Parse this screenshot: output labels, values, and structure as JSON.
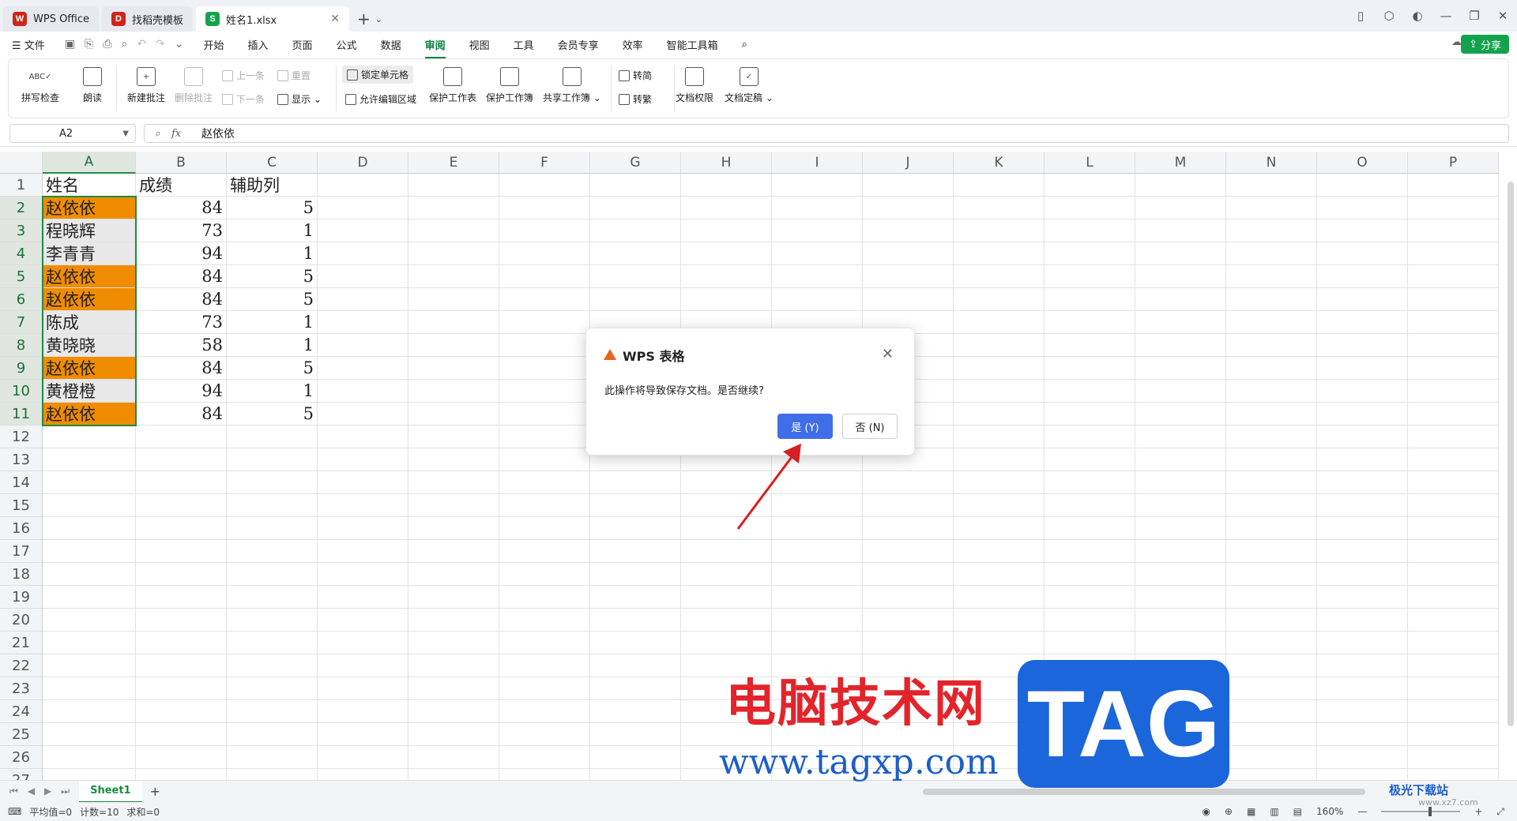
{
  "tabs": [
    {
      "label": "WPS Office",
      "logo": "W",
      "color": "#d0241b",
      "active": false
    },
    {
      "label": "找稻壳模板",
      "logo": "D",
      "color": "#d0241b",
      "active": false
    },
    {
      "label": "姓名1.xlsx",
      "logo": "S",
      "color": "#14a34d",
      "active": true
    }
  ],
  "menu": {
    "file": "文件",
    "items": [
      "开始",
      "插入",
      "页面",
      "公式",
      "数据",
      "审阅",
      "视图",
      "工具",
      "会员专享",
      "效率",
      "智能工具箱"
    ],
    "active": "审阅",
    "share": "分享"
  },
  "ribbon": {
    "spellcheck": "拼写检查",
    "read": "朗读",
    "new_comment": "新建批注",
    "delete_comment": "删除批注",
    "prev": "上一条",
    "next": "下一条",
    "reset": "重置",
    "show": "显示",
    "lock_cell": "锁定单元格",
    "allow_edit": "允许编辑区域",
    "protect_sheet": "保护工作表",
    "protect_book": "保护工作簿",
    "share_book": "共享工作簿",
    "to_simplified": "转简",
    "to_traditional": "转繁",
    "doc_permission": "文档权限",
    "doc_finalize": "文档定稿"
  },
  "formula_bar": {
    "name_box": "A2",
    "value": "赵依依"
  },
  "columns": [
    "A",
    "B",
    "C",
    "D",
    "E",
    "F",
    "G",
    "H",
    "I",
    "J",
    "K",
    "L",
    "M",
    "N",
    "O",
    "P"
  ],
  "rows": [
    "1",
    "2",
    "3",
    "4",
    "5",
    "6",
    "7",
    "8",
    "9",
    "10",
    "11",
    "12",
    "13",
    "14",
    "15",
    "16",
    "17",
    "18",
    "19",
    "20",
    "21",
    "22",
    "23",
    "24",
    "25",
    "26",
    "27"
  ],
  "table": {
    "headers": [
      "姓名",
      "成绩",
      "辅助列"
    ],
    "data": [
      {
        "name": "赵依依",
        "score": "84",
        "aux": "5"
      },
      {
        "name": "程晓辉",
        "score": "73",
        "aux": "1"
      },
      {
        "name": "李青青",
        "score": "94",
        "aux": "1"
      },
      {
        "name": "赵依依",
        "score": "84",
        "aux": "5"
      },
      {
        "name": "赵依依",
        "score": "84",
        "aux": "5"
      },
      {
        "name": "陈成",
        "score": "73",
        "aux": "1"
      },
      {
        "name": "黄晓晓",
        "score": "58",
        "aux": "1"
      },
      {
        "name": "赵依依",
        "score": "84",
        "aux": "5"
      },
      {
        "name": "黄橙橙",
        "score": "94",
        "aux": "1"
      },
      {
        "name": "赵依依",
        "score": "84",
        "aux": "5"
      }
    ],
    "highlight_color": "#f08c00",
    "plain_color": "#e8e8e8"
  },
  "dialog": {
    "title": "WPS 表格",
    "message": "此操作将导致保存文档。是否继续?",
    "yes": "是 (Y)",
    "no": "否 (N)"
  },
  "sheet": {
    "tab": "Sheet1"
  },
  "status": {
    "avg": "平均值=0",
    "count": "计数=10",
    "sum": "求和=0",
    "zoom": "160%"
  },
  "watermark": {
    "text": "电脑技术网",
    "url": "www.tagxp.com",
    "tag": "TAG",
    "site2": "极光下载站",
    "site2_url": "www.xz7.com"
  }
}
